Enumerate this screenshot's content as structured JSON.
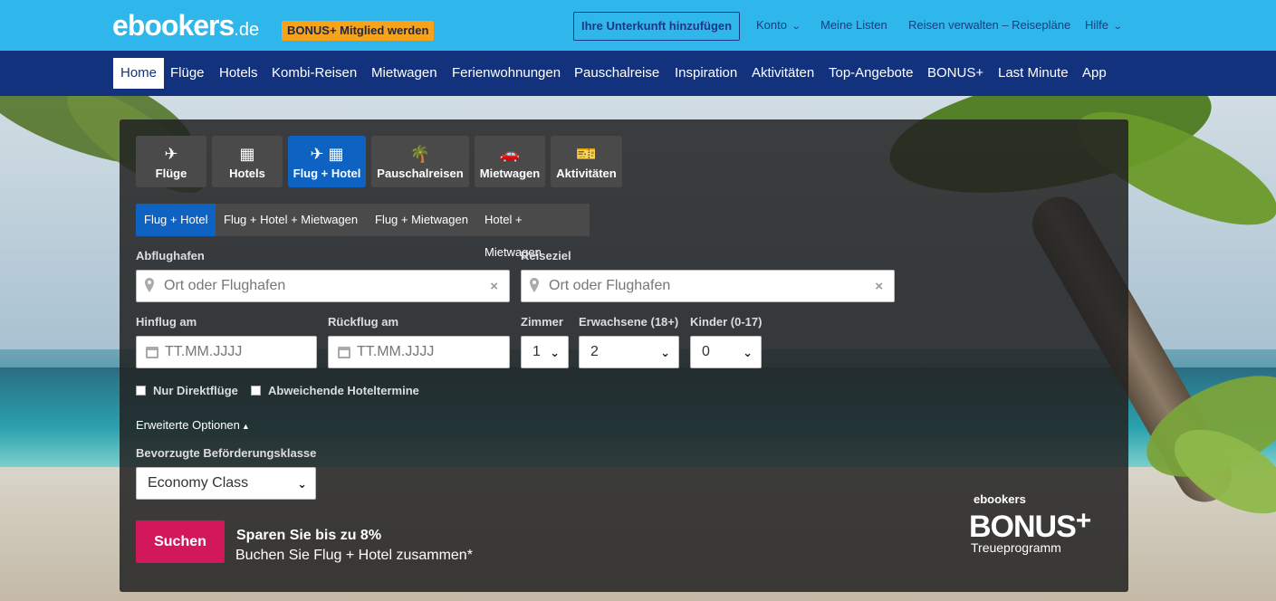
{
  "header": {
    "logo_main": "ebookers",
    "logo_tld": ".de",
    "bonus_badge": "BONUS+ Mitglied werden",
    "add_property": "Ihre Unterkunft hinzufügen",
    "links": [
      {
        "label": "Konto",
        "dropdown": true
      },
      {
        "label": "Meine Listen",
        "dropdown": false
      },
      {
        "label": "Reisen verwalten – Reisepläne",
        "dropdown": false
      },
      {
        "label": "Hilfe",
        "dropdown": true
      }
    ]
  },
  "nav": {
    "items": [
      "Home",
      "Flüge",
      "Hotels",
      "Kombi-Reisen",
      "Mietwagen",
      "Ferienwohnungen",
      "Pauschalreise",
      "Inspiration",
      "Aktivitäten",
      "Top-Angebote",
      "BONUS+",
      "Last Minute",
      "App"
    ],
    "active": "Home"
  },
  "search": {
    "product_tabs": [
      {
        "label": "Flüge",
        "icon": "plane-icon"
      },
      {
        "label": "Hotels",
        "icon": "building-icon"
      },
      {
        "label": "Flug + Hotel",
        "icon": "plane-building-icon"
      },
      {
        "label": "Pauschalreisen",
        "icon": "palm-icon"
      },
      {
        "label": "Mietwagen",
        "icon": "car-icon"
      },
      {
        "label": "Aktivitäten",
        "icon": "ticket-icon"
      }
    ],
    "active_product": "Flug + Hotel",
    "sub_tabs": [
      "Flug + Hotel",
      "Flug + Hotel + Mietwagen",
      "Flug + Mietwagen",
      "Hotel + Mietwagen"
    ],
    "active_sub": "Flug + Hotel",
    "origin": {
      "label": "Abflughafen",
      "placeholder": "Ort oder Flughafen",
      "value": ""
    },
    "destination": {
      "label": "Reiseziel",
      "placeholder": "Ort oder Flughafen",
      "value": ""
    },
    "depart": {
      "label": "Hinflug am",
      "placeholder": "TT.MM.JJJJ"
    },
    "return": {
      "label": "Rückflug am",
      "placeholder": "TT.MM.JJJJ"
    },
    "rooms": {
      "label": "Zimmer",
      "value": "1"
    },
    "adults": {
      "label": "Erwachsene (18+)",
      "value": "2"
    },
    "children": {
      "label": "Kinder (0-17)",
      "value": "0"
    },
    "checkbox_direct": "Nur Direktflüge",
    "checkbox_hotel_dates": "Abweichende Hoteltermine",
    "advanced_options": "Erweiterte Optionen",
    "class_label": "Bevorzugte Beförderungsklasse",
    "class_value": "Economy Class",
    "search_button": "Suchen",
    "promo_title": "Sparen Sie bis zu 8%",
    "promo_text": "Buchen Sie Flug + Hotel zusammen*"
  },
  "bonus_logo": {
    "brand": "ebookers",
    "name": "BONUS",
    "plus": "+",
    "tagline": "Treueprogramm"
  }
}
